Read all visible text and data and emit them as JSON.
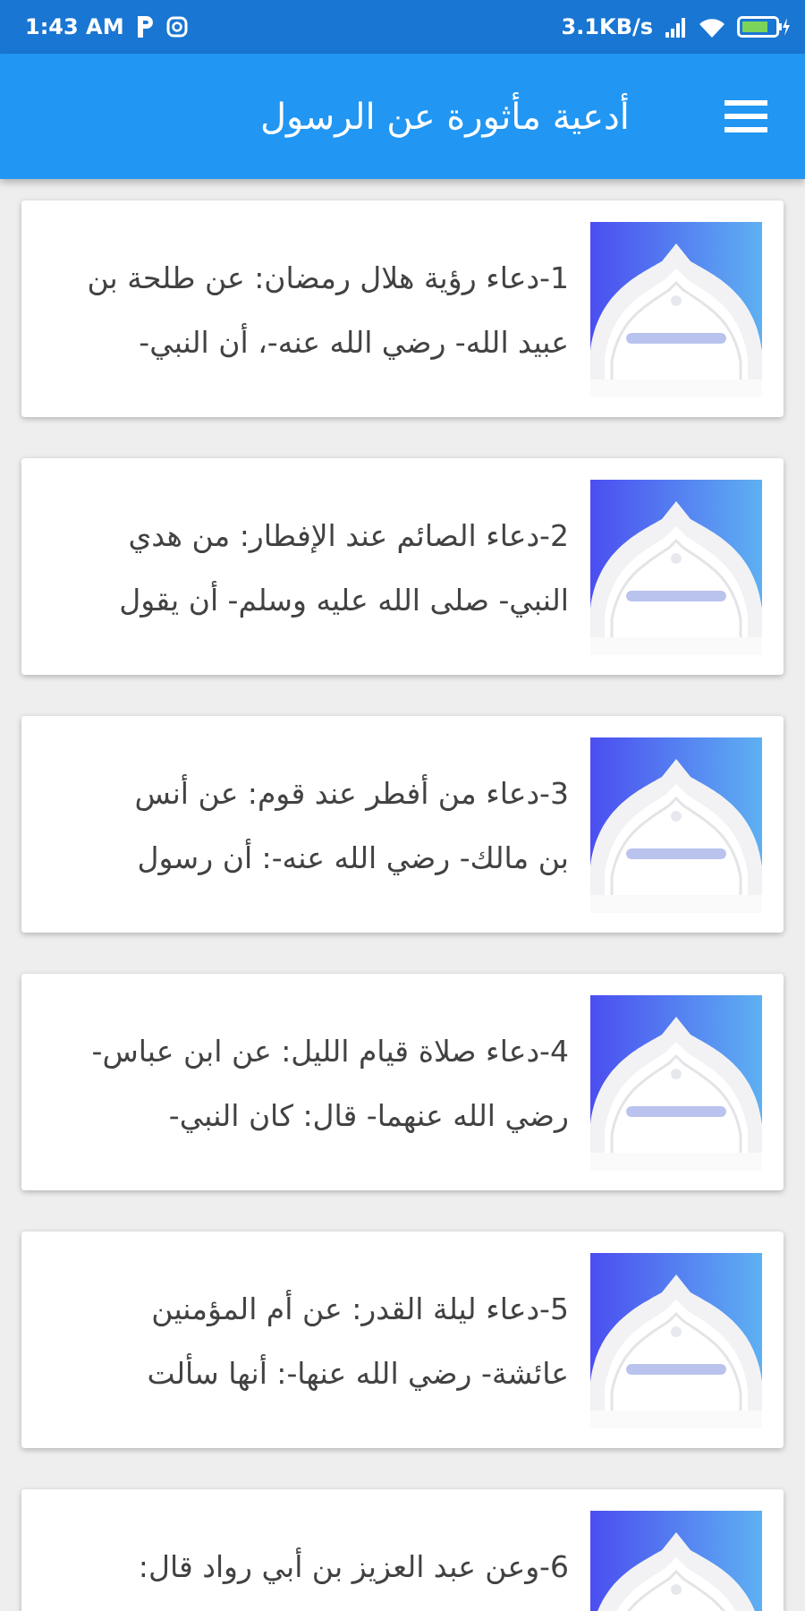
{
  "status_bar": {
    "time": "1:43 AM",
    "speed": "3.1KB/s"
  },
  "app_bar": {
    "title": "أدعية مأثورة عن الرسول"
  },
  "items": [
    {
      "text": "1-دعاء رؤية هلال رمضان: عن طلحة بن\nعبيد الله- رضي الله عنه-، أن النبي-"
    },
    {
      "text": "2-دعاء الصائم عند الإفطار: من هدي\nالنبي- صلى الله عليه وسلم- أن يقول"
    },
    {
      "text": "3-دعاء من أفطر عند قوم: عن أنس\nبن مالك- رضي الله عنه-: أن رسول"
    },
    {
      "text": "4-دعاء صلاة قيام الليل: عن ابن عباس-\nرضي الله عنهما- قال: كان النبي-"
    },
    {
      "text": "5-دعاء ليلة القدر: عن أم المؤمنين\nعائشة- رضي الله عنها-: أنها سألت"
    },
    {
      "text": "6-وعن عبد العزيز بن أبي رواد قال:"
    }
  ]
}
